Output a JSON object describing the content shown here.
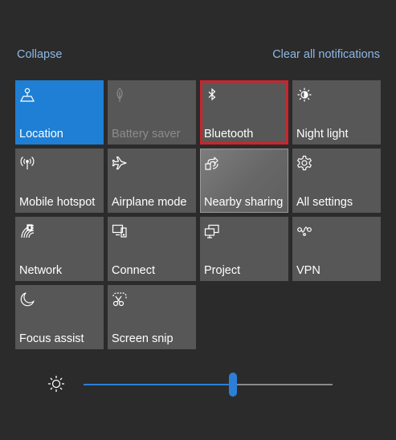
{
  "header": {
    "collapse_label": "Collapse",
    "clear_all_label": "Clear all notifications"
  },
  "tiles": [
    {
      "label": "Location",
      "icon": "location-icon",
      "state": "on"
    },
    {
      "label": "Battery saver",
      "icon": "battery-saver-icon",
      "state": "disabled"
    },
    {
      "label": "Bluetooth",
      "icon": "bluetooth-icon",
      "state": "off"
    },
    {
      "label": "Night light",
      "icon": "night-light-icon",
      "state": "off"
    },
    {
      "label": "Mobile hotspot",
      "icon": "mobile-hotspot-icon",
      "state": "off"
    },
    {
      "label": "Airplane mode",
      "icon": "airplane-icon",
      "state": "off"
    },
    {
      "label": "Nearby sharing",
      "icon": "nearby-sharing-icon",
      "state": "hover"
    },
    {
      "label": "All settings",
      "icon": "gear-icon",
      "state": "off"
    },
    {
      "label": "Network",
      "icon": "network-icon",
      "state": "off"
    },
    {
      "label": "Connect",
      "icon": "connect-icon",
      "state": "off"
    },
    {
      "label": "Project",
      "icon": "project-icon",
      "state": "off"
    },
    {
      "label": "VPN",
      "icon": "vpn-icon",
      "state": "off"
    },
    {
      "label": "Focus assist",
      "icon": "moon-icon",
      "state": "off"
    },
    {
      "label": "Screen snip",
      "icon": "screen-snip-icon",
      "state": "off"
    }
  ],
  "brightness": {
    "icon": "brightness-icon",
    "level_fraction": 0.6
  },
  "colors": {
    "background": "#2b2b2b",
    "tile": "#575757",
    "accent": "#1e7fd4",
    "highlight_border": "#c8262d",
    "link": "#8fb8e6"
  }
}
